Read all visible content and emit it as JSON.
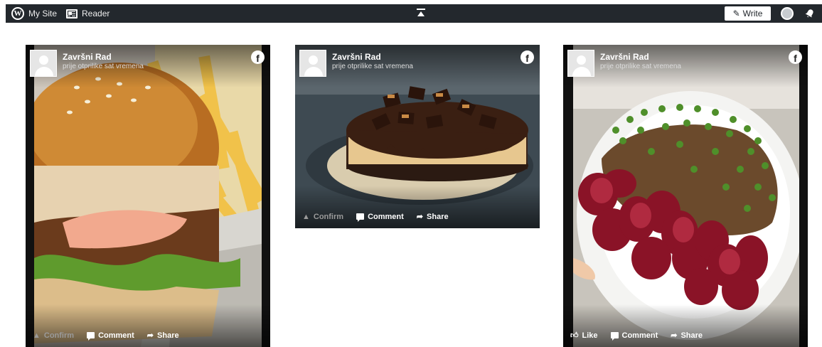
{
  "topbar": {
    "my_site": "My Site",
    "reader": "Reader",
    "write": "Write"
  },
  "icons": {
    "site": "wordpress-icon",
    "reader": "reader-icon",
    "center": "collapse-icon",
    "write": "pen-icon",
    "avatar": "avatar",
    "notifications": "bell-icon",
    "facebook": "facebook-icon",
    "comment": "comment-icon",
    "share": "share-icon",
    "like": "thumbs-up-icon",
    "confirm": "warning-icon"
  },
  "cards": [
    {
      "author": "Završni Rad",
      "time": "prije otprilike sat vremena",
      "confirm": "Confirm",
      "comment": "Comment",
      "share": "Share"
    },
    {
      "author": "Završni Rad",
      "time": "prije otprilike sat vremena",
      "confirm": "Confirm",
      "comment": "Comment",
      "share": "Share"
    },
    {
      "author": "Završni Rad",
      "time": "prije otprilike sat vremena",
      "like": "Like",
      "comment": "Comment",
      "share": "Share"
    }
  ],
  "colors": {
    "topbar": "#23282d",
    "card_bg": "#111111"
  }
}
